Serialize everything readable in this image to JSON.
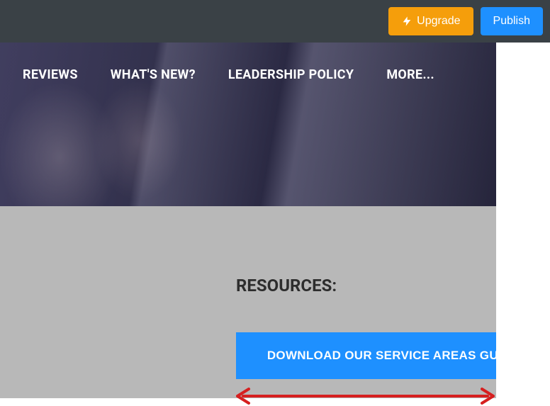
{
  "topbar": {
    "upgrade_label": "Upgrade",
    "publish_label": "Publish"
  },
  "nav": {
    "items": [
      {
        "label": "REVIEWS"
      },
      {
        "label": "WHAT'S NEW?"
      },
      {
        "label": "LEADERSHIP POLICY"
      },
      {
        "label": "MORE..."
      }
    ]
  },
  "main": {
    "section_heading": "RESOURCES:",
    "download_label": "DOWNLOAD OUR SERVICE AREAS GUIDE"
  },
  "colors": {
    "topbar_bg": "#3a4146",
    "upgrade": "#f59e0b",
    "publish": "#1e90ff",
    "download": "#1e90ff",
    "content_bg": "#b8b8b8",
    "annotation": "#d61f1f"
  }
}
